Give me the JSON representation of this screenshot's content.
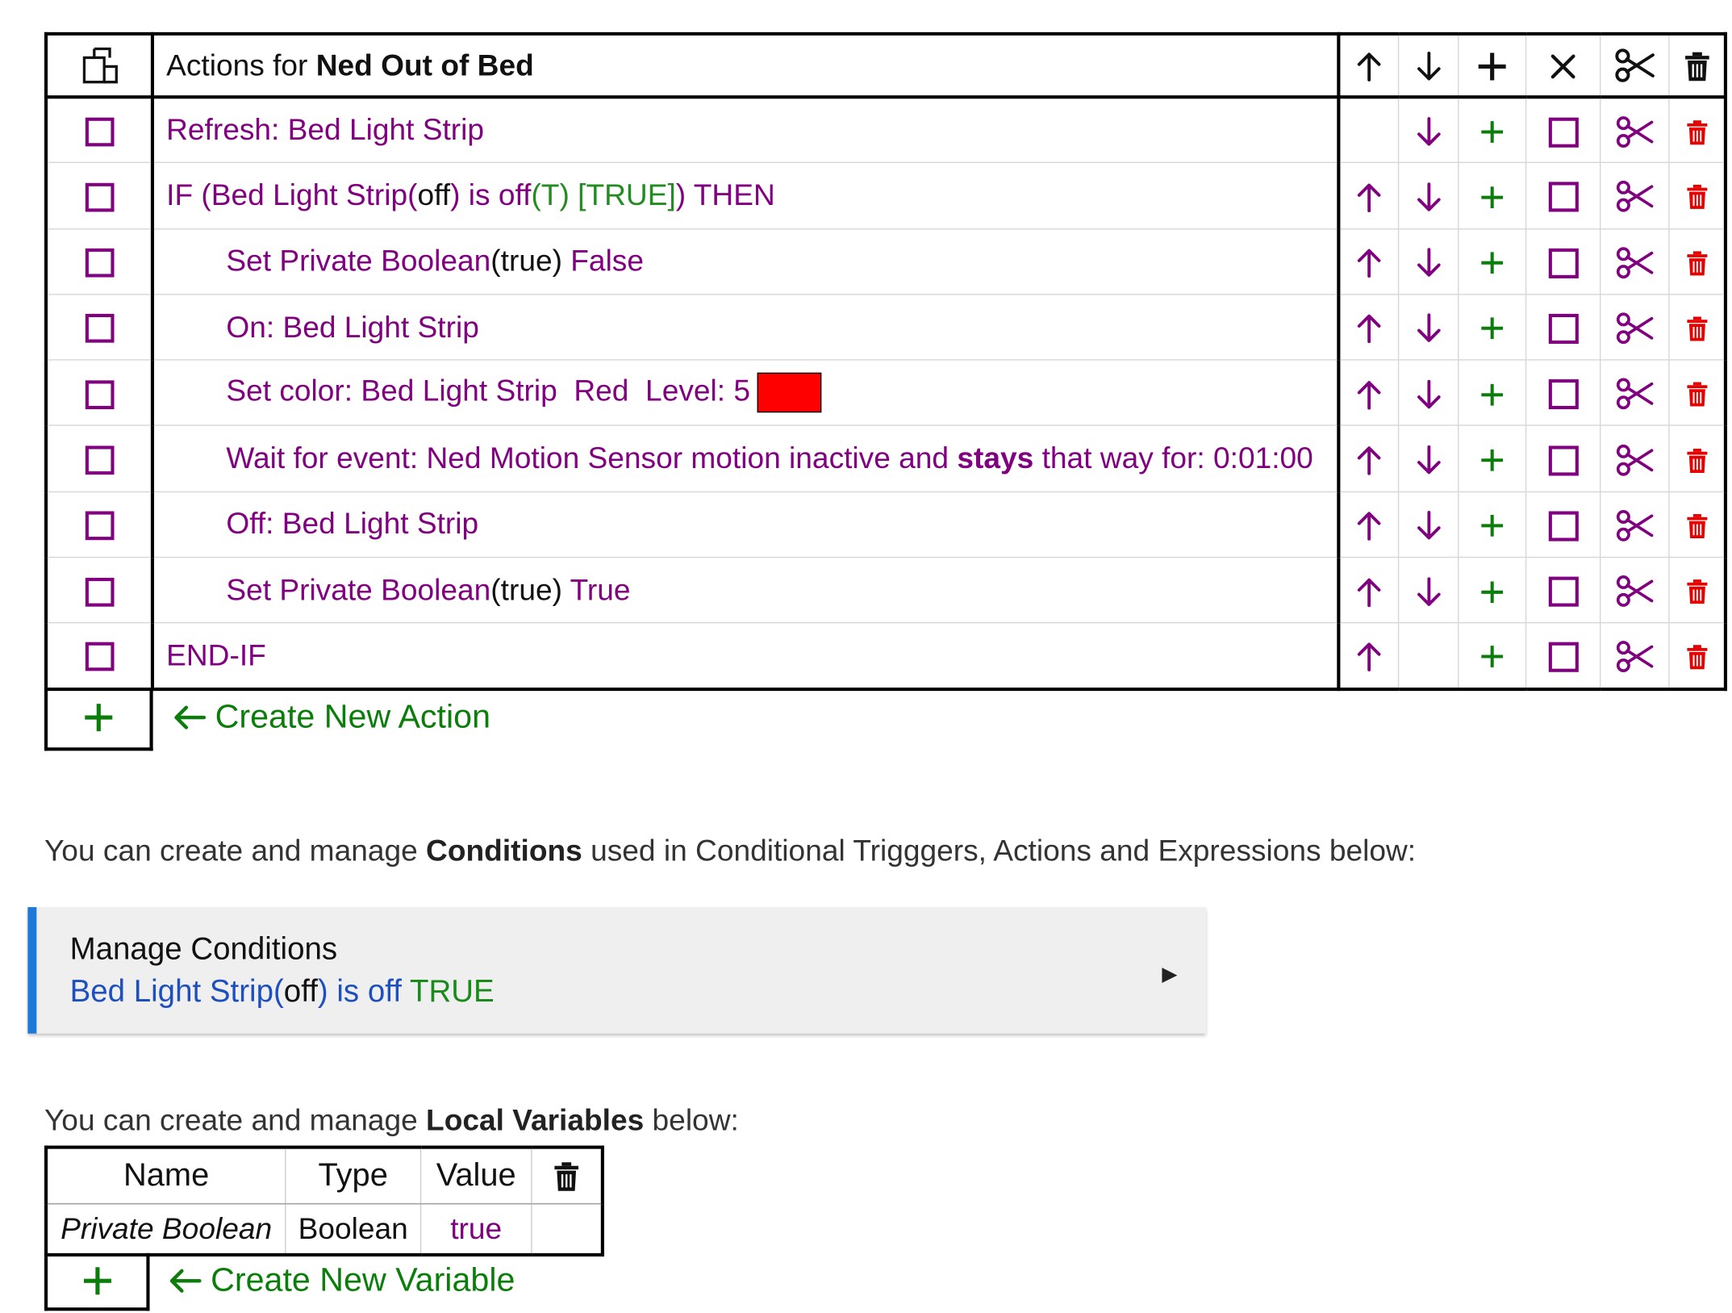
{
  "actions_table": {
    "header_prefix": "Actions for ",
    "rule_name": "Ned Out of Bed",
    "rows": [
      {
        "parts": [
          "Refresh: Bed Light Strip"
        ]
      },
      {
        "parts": [
          "IF (Bed Light Strip(",
          "off",
          ") is off",
          "(T) [TRUE]",
          ") THEN"
        ]
      },
      {
        "parts": [
          "Set Private Boolean",
          "(true)",
          " False"
        ]
      },
      {
        "parts": [
          "On: Bed Light Strip"
        ]
      },
      {
        "parts": [
          "Set color: Bed Light Strip  Red  Level: 5"
        ],
        "swatch_color": "#ff0000"
      },
      {
        "parts": [
          "Wait for event: Ned Motion Sensor motion inactive and ",
          "stays",
          " that way for: 0:01:00"
        ]
      },
      {
        "parts": [
          "Off: Bed Light Strip"
        ]
      },
      {
        "parts": [
          "Set Private Boolean",
          "(true)",
          " True"
        ]
      },
      {
        "parts": [
          "END-IF"
        ]
      }
    ]
  },
  "create_action_label": "Create New Action",
  "conditions_intro": {
    "before": "You can create and manage ",
    "bold": "Conditions",
    "after": " used in Conditional Trigggers, Actions and Expressions below:"
  },
  "manage_conditions": {
    "title": "Manage Conditions",
    "sub_a": "Bed Light Strip(",
    "sub_b": "off",
    "sub_c": ") is off ",
    "sub_d": "TRUE"
  },
  "variables_intro": {
    "before": "You can create and manage ",
    "bold": "Local Variables",
    "after": " below:"
  },
  "variables_table": {
    "headers": [
      "Name",
      "Type",
      "Value"
    ],
    "row": {
      "name": "Private Boolean",
      "type": "Boolean",
      "value": "true"
    }
  },
  "create_variable_label": "Create New Variable",
  "colors": {
    "purple": "#800080",
    "green": "#228b22",
    "red": "#e60000",
    "accent_blue": "#1e78d7"
  }
}
